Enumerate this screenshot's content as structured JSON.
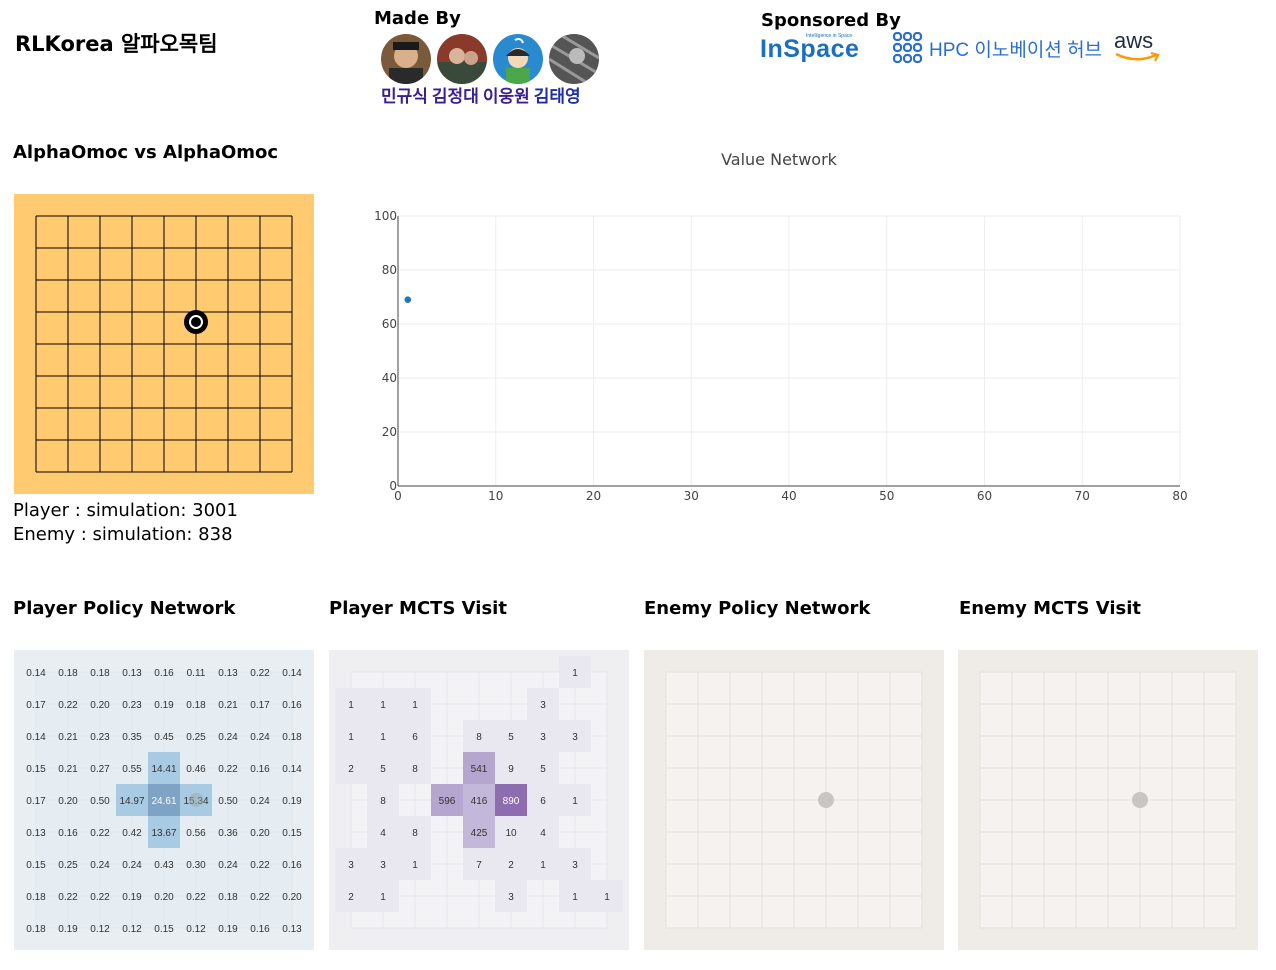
{
  "header": {
    "title": "RLKorea 알파오목팀",
    "made_by": "Made By",
    "sponsored_by": "Sponsored By",
    "authors": [
      {
        "name": "민규식",
        "color": "#3b1f8f"
      },
      {
        "name": "김정대",
        "color": "#3b1f8f"
      },
      {
        "name": "이웅원",
        "color": "#3b1f8f"
      },
      {
        "name": "김태영",
        "color": "#1f2f9f"
      }
    ],
    "sponsors": {
      "inspace": {
        "name": "InSpace",
        "tagline": "Intelligence in Space"
      },
      "hpc": {
        "name": "HPC 이노베이션 허브"
      },
      "aws": {
        "name": "aws"
      }
    }
  },
  "game": {
    "title": "AlphaOmoc vs AlphaOmoc",
    "player_sim": "Player : simulation: 3001",
    "enemy_sim": "Enemy : simulation: 838",
    "board_color": "#ffca70",
    "stone": {
      "row": 4,
      "col": 5,
      "color": "black"
    }
  },
  "chart_data": {
    "type": "scatter",
    "title": "Value Network",
    "xlabel": "",
    "ylabel": "",
    "xlim": [
      0,
      80
    ],
    "ylim": [
      0,
      100
    ],
    "x_ticks": [
      0,
      10,
      20,
      30,
      40,
      50,
      60,
      70,
      80
    ],
    "y_ticks": [
      0,
      20,
      40,
      60,
      80,
      100
    ],
    "grid": true,
    "series": [
      {
        "x": [
          1
        ],
        "y": [
          69
        ],
        "color": "#1f77b4"
      }
    ]
  },
  "panels": {
    "player_policy": {
      "title": "Player Policy Network",
      "values": [
        [
          "0.14",
          "0.18",
          "0.18",
          "0.13",
          "0.16",
          "0.11",
          "0.13",
          "0.22",
          "0.14"
        ],
        [
          "0.17",
          "0.22",
          "0.20",
          "0.23",
          "0.19",
          "0.18",
          "0.21",
          "0.17",
          "0.16"
        ],
        [
          "0.14",
          "0.21",
          "0.23",
          "0.35",
          "0.45",
          "0.25",
          "0.24",
          "0.24",
          "0.18"
        ],
        [
          "0.15",
          "0.21",
          "0.27",
          "0.55",
          "14.41",
          "0.46",
          "0.22",
          "0.16",
          "0.14"
        ],
        [
          "0.17",
          "0.20",
          "0.50",
          "14.97",
          "24.61",
          "15.34",
          "0.50",
          "0.24",
          "0.19"
        ],
        [
          "0.13",
          "0.16",
          "0.22",
          "0.42",
          "13.67",
          "0.56",
          "0.36",
          "0.20",
          "0.15"
        ],
        [
          "0.15",
          "0.25",
          "0.24",
          "0.24",
          "0.43",
          "0.30",
          "0.24",
          "0.22",
          "0.16"
        ],
        [
          "0.18",
          "0.22",
          "0.22",
          "0.19",
          "0.20",
          "0.22",
          "0.18",
          "0.22",
          "0.20"
        ],
        [
          "0.18",
          "0.19",
          "0.12",
          "0.12",
          "0.15",
          "0.12",
          "0.19",
          "0.16",
          "0.13"
        ]
      ]
    },
    "player_mcts": {
      "title": "Player MCTS Visit",
      "values": [
        [
          "",
          "",
          "",
          "",
          "",
          "",
          "",
          "1",
          ""
        ],
        [
          "1",
          "1",
          "1",
          "",
          "",
          "",
          "3",
          "",
          ""
        ],
        [
          "1",
          "1",
          "6",
          "",
          "8",
          "5",
          "3",
          "3",
          ""
        ],
        [
          "2",
          "5",
          "8",
          "",
          "541",
          "9",
          "5",
          "",
          ""
        ],
        [
          "",
          "8",
          "",
          "596",
          "416",
          "890",
          "6",
          "1",
          ""
        ],
        [
          "",
          "4",
          "8",
          "",
          "425",
          "10",
          "4",
          "",
          ""
        ],
        [
          "3",
          "3",
          "1",
          "",
          "7",
          "2",
          "1",
          "3",
          ""
        ],
        [
          "2",
          "1",
          "",
          "",
          "",
          "3",
          "",
          "1",
          "1"
        ],
        [
          "",
          "",
          "",
          "",
          "",
          "",
          "",
          "",
          ""
        ]
      ]
    },
    "enemy_policy": {
      "title": "Enemy Policy Network"
    },
    "enemy_mcts": {
      "title": "Enemy MCTS Visit"
    }
  }
}
